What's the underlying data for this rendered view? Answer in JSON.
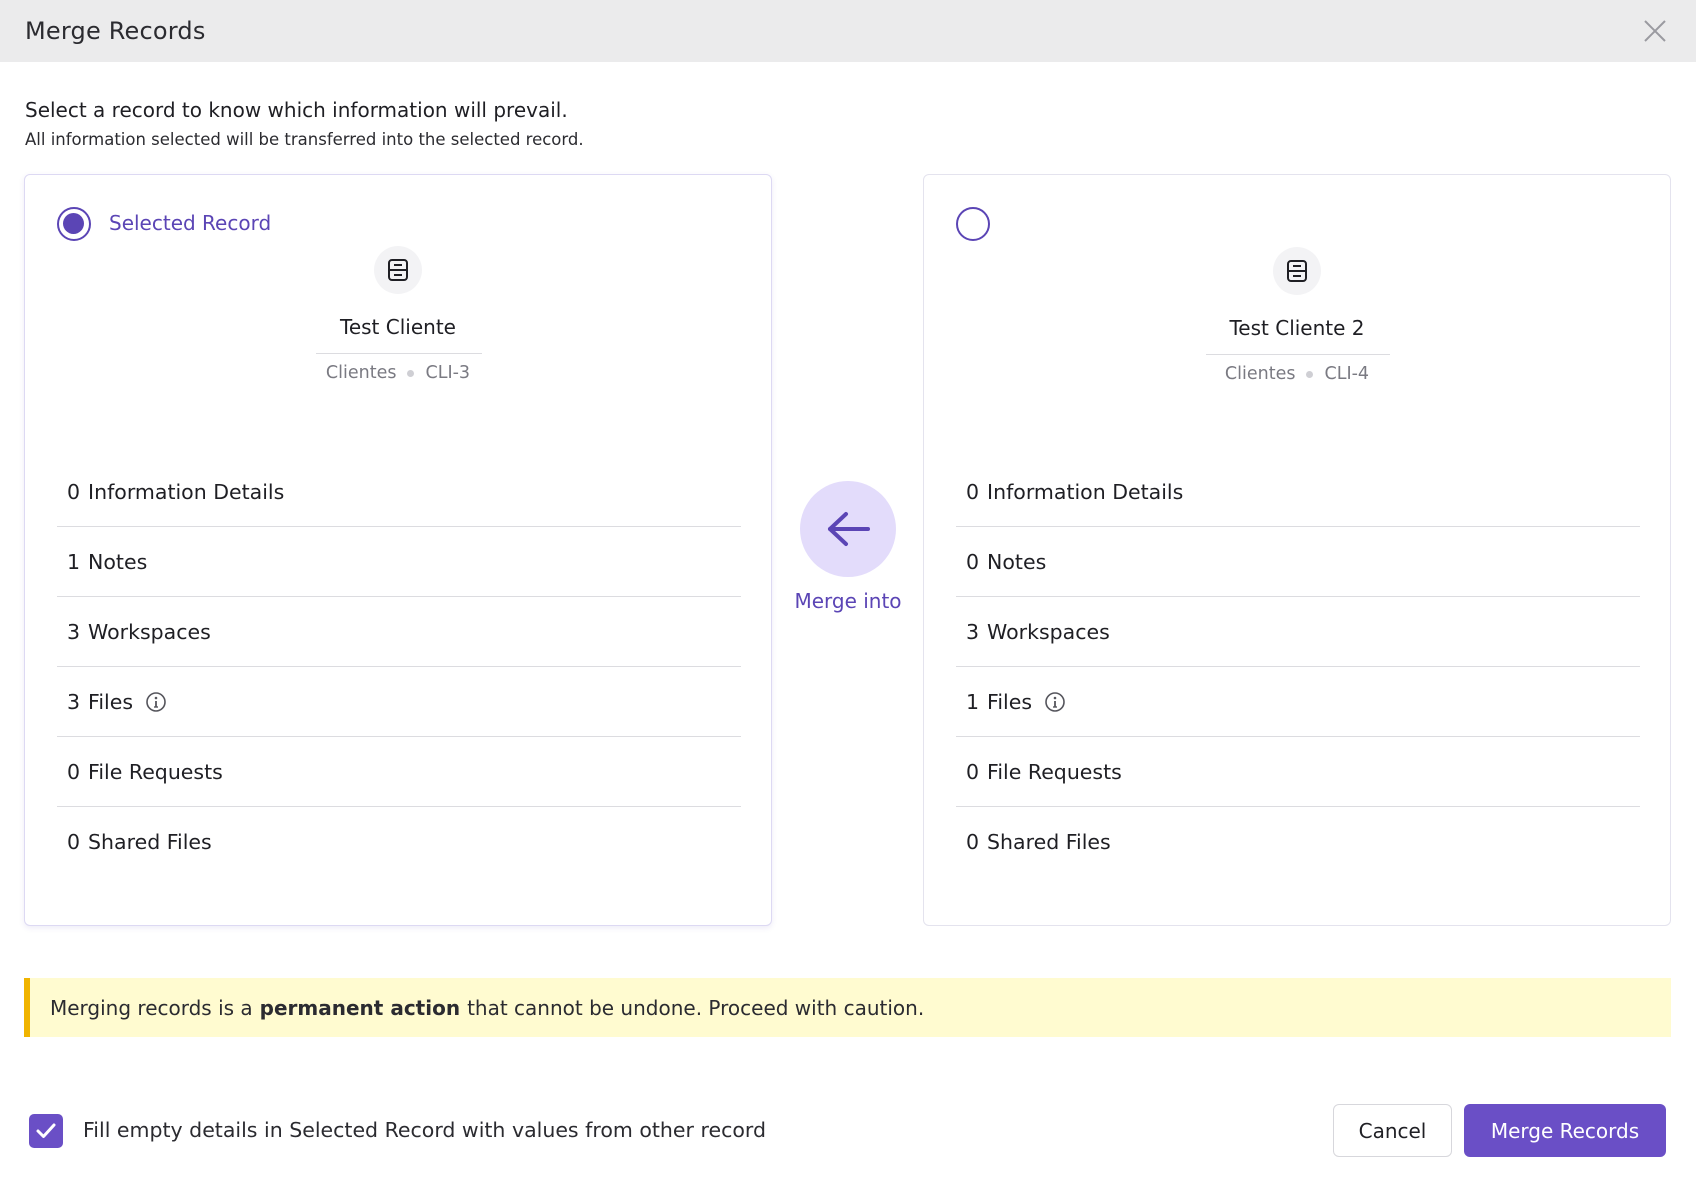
{
  "header": {
    "title": "Merge Records"
  },
  "intro": {
    "title": "Select a record to know which information will prevail.",
    "subtitle": "All information selected will be transferred into the selected record."
  },
  "left_record": {
    "selected": true,
    "radio_label": "Selected Record",
    "name": "Test Cliente",
    "module": "Clientes",
    "id": "CLI-3",
    "stats": [
      {
        "count": "0",
        "label": "Information Details"
      },
      {
        "count": "1",
        "label": "Notes"
      },
      {
        "count": "3",
        "label": "Workspaces"
      },
      {
        "count": "3",
        "label": "Files"
      },
      {
        "count": "0",
        "label": "File Requests"
      },
      {
        "count": "0",
        "label": "Shared Files"
      }
    ]
  },
  "right_record": {
    "selected": false,
    "radio_label": "",
    "name": "Test Cliente 2",
    "module": "Clientes",
    "id": "CLI-4",
    "stats": [
      {
        "count": "0",
        "label": "Information Details"
      },
      {
        "count": "0",
        "label": "Notes"
      },
      {
        "count": "3",
        "label": "Workspaces"
      },
      {
        "count": "1",
        "label": "Files"
      },
      {
        "count": "0",
        "label": "File Requests"
      },
      {
        "count": "0",
        "label": "Shared Files"
      }
    ]
  },
  "merge_direction": {
    "label": "Merge into",
    "icon": "arrow-left-icon"
  },
  "warning": {
    "before": "Merging records is a",
    "emphasis": "permanent action",
    "after": "that cannot be undone. Proceed with caution."
  },
  "fill_empty": {
    "checked": true,
    "label": "Fill empty details in Selected Record with values from other record"
  },
  "buttons": {
    "cancel": "Cancel",
    "merge": "Merge Records"
  },
  "colors": {
    "accent": "#6a4fc6",
    "accent_light": "#e3dcfb",
    "warning_bg": "#fffbd0",
    "warning_border": "#f0b400"
  }
}
